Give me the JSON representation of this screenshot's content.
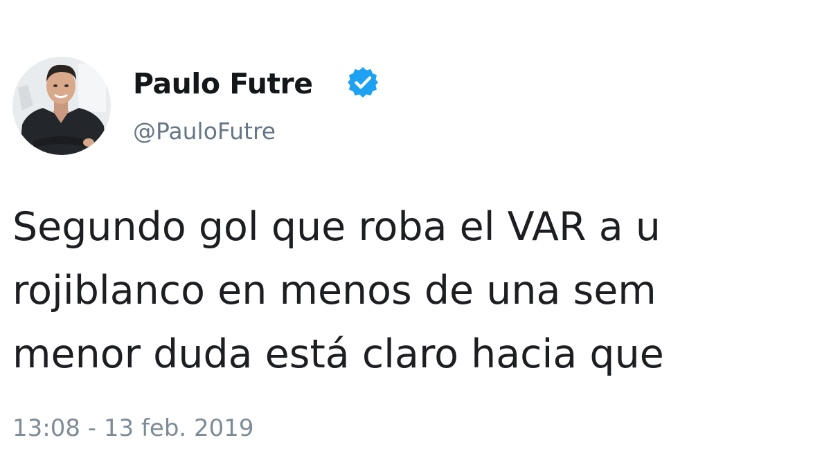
{
  "author": {
    "display_name": "Paulo Futre",
    "handle": "@PauloFutre",
    "verified_icon": "verified-badge-icon",
    "avatar": "profile-photo"
  },
  "tweet": {
    "lines": [
      "Segundo gol que roba el VAR a u",
      "rojiblanco en menos de una sem",
      "menor duda está claro hacia que"
    ]
  },
  "timestamp": "13:08 - 13 feb. 2019",
  "colors": {
    "name": "#14171a",
    "handle": "#657786",
    "text": "#1c1e21",
    "timestamp": "#7d8b97",
    "verified": "#1da1f2",
    "background": "#ffffff"
  }
}
